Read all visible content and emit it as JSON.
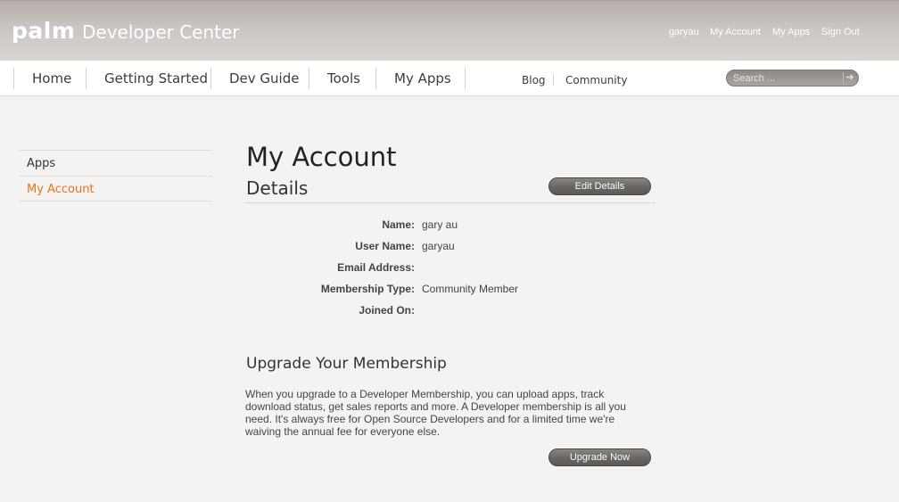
{
  "header": {
    "logo": "palm",
    "site_title": "Developer Center",
    "top_links": [
      "garyau",
      "My Account",
      "My Apps",
      "Sign Out"
    ]
  },
  "nav": {
    "main_items": [
      "Home",
      "Getting Started",
      "Dev Guide",
      "Tools",
      "My Apps"
    ],
    "secondary_items": [
      "Blog",
      "Community"
    ],
    "search_placeholder": "Search ...",
    "search_go_icon": "arrow-right-icon"
  },
  "sidebar": {
    "items": [
      {
        "label": "Apps",
        "active": false
      },
      {
        "label": "My Account",
        "active": true
      }
    ]
  },
  "main": {
    "page_title": "My Account",
    "details_title": "Details",
    "edit_button": "Edit Details",
    "details": [
      {
        "label": "Name:",
        "value": "gary au"
      },
      {
        "label": "User Name:",
        "value": "garyau"
      },
      {
        "label": "Email Address:",
        "value": ""
      },
      {
        "label": "Membership Type:",
        "value": "Community Member"
      },
      {
        "label": "Joined On:",
        "value": ""
      }
    ],
    "upgrade_title": "Upgrade Your Membership",
    "upgrade_text": "When you upgrade to a Developer Membership, you can upload apps, track download status, get sales reports and more. A Developer membership is all you need. It's always free for Open Source Developers and for a limited time we're waiving the annual fee for everyone else.",
    "upgrade_button": "Upgrade Now"
  },
  "colors": {
    "accent": "#e8731c",
    "header_bg": "#c4bfbc",
    "button_bg": "#6a6764"
  }
}
